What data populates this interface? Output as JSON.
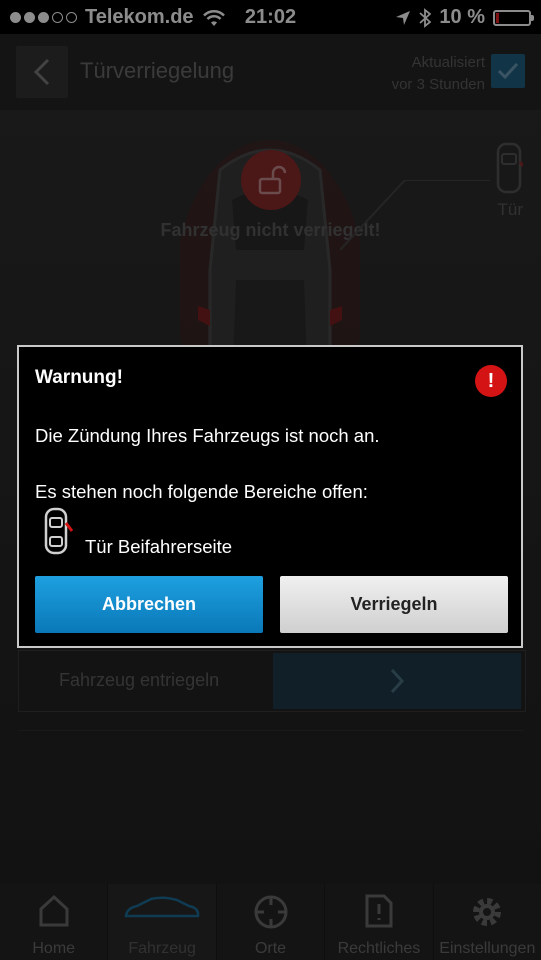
{
  "status_bar": {
    "carrier": "Telekom.de",
    "time": "21:02",
    "battery": "10 %",
    "battery_level": 0.1
  },
  "header": {
    "title": "Türverriegelung",
    "updated_line1": "Aktualisiert",
    "updated_line2": "vor 3 Stunden"
  },
  "vehicle": {
    "status_text": "Fahrzeug nicht verriegelt!",
    "door_label": "Tür",
    "unlock_label": "Fahrzeug entriegeln"
  },
  "dialog": {
    "title": "Warnung!",
    "alert_symbol": "!",
    "message": "Die Zündung Ihres Fahrzeugs ist noch an.",
    "open_areas_text": "Es stehen noch folgende Bereiche offen:",
    "open_item": "Tür Beifahrerseite",
    "cancel_label": "Abbrechen",
    "lock_label": "Verriegeln"
  },
  "tabs": [
    {
      "label": "Home",
      "icon": "home-icon"
    },
    {
      "label": "Fahrzeug",
      "icon": "car-icon",
      "active": true
    },
    {
      "label": "Orte",
      "icon": "crosshair-icon"
    },
    {
      "label": "Rechtliches",
      "icon": "document-icon"
    },
    {
      "label": "Einstellungen",
      "icon": "gear-icon"
    }
  ],
  "colors": {
    "accent_blue": "#0a8fd0",
    "alert_red": "#d41414",
    "background": "#1c1c1c"
  }
}
